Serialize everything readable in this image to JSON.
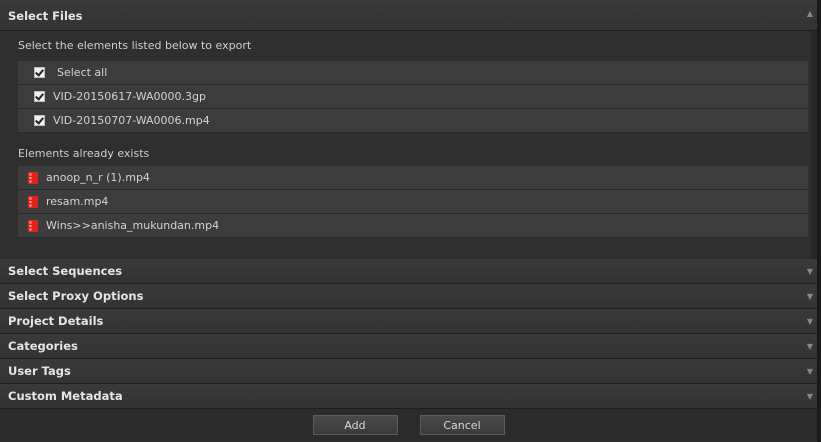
{
  "sections": {
    "select_files": {
      "title": "Select Files",
      "instruction": "Select the elements listed below to export",
      "select_all_label": "Select all",
      "files": [
        {
          "name": "VID-20150617-WA0000.3gp",
          "checked": true
        },
        {
          "name": "VID-20150707-WA0006.mp4",
          "checked": true
        }
      ],
      "exists_label": "Elements already exists",
      "existing": [
        {
          "name": "anoop_n_r (1).mp4"
        },
        {
          "name": "resam.mp4"
        },
        {
          "name": "Wins>>anisha_mukundan.mp4"
        }
      ]
    },
    "collapsed": [
      {
        "title": "Select Sequences"
      },
      {
        "title": "Select Proxy Options"
      },
      {
        "title": "Project Details"
      },
      {
        "title": "Categories"
      },
      {
        "title": "User Tags"
      },
      {
        "title": "Custom Metadata"
      }
    ]
  },
  "footer": {
    "add_label": "Add",
    "cancel_label": "Cancel"
  },
  "colors": {
    "exists_icon": "#e0231b",
    "background": "#2b2b2b"
  },
  "icons": {
    "checkbox": "checkbox-checked-icon",
    "exists": "file-exists-icon",
    "expand": "triangle-arrow-icon"
  }
}
